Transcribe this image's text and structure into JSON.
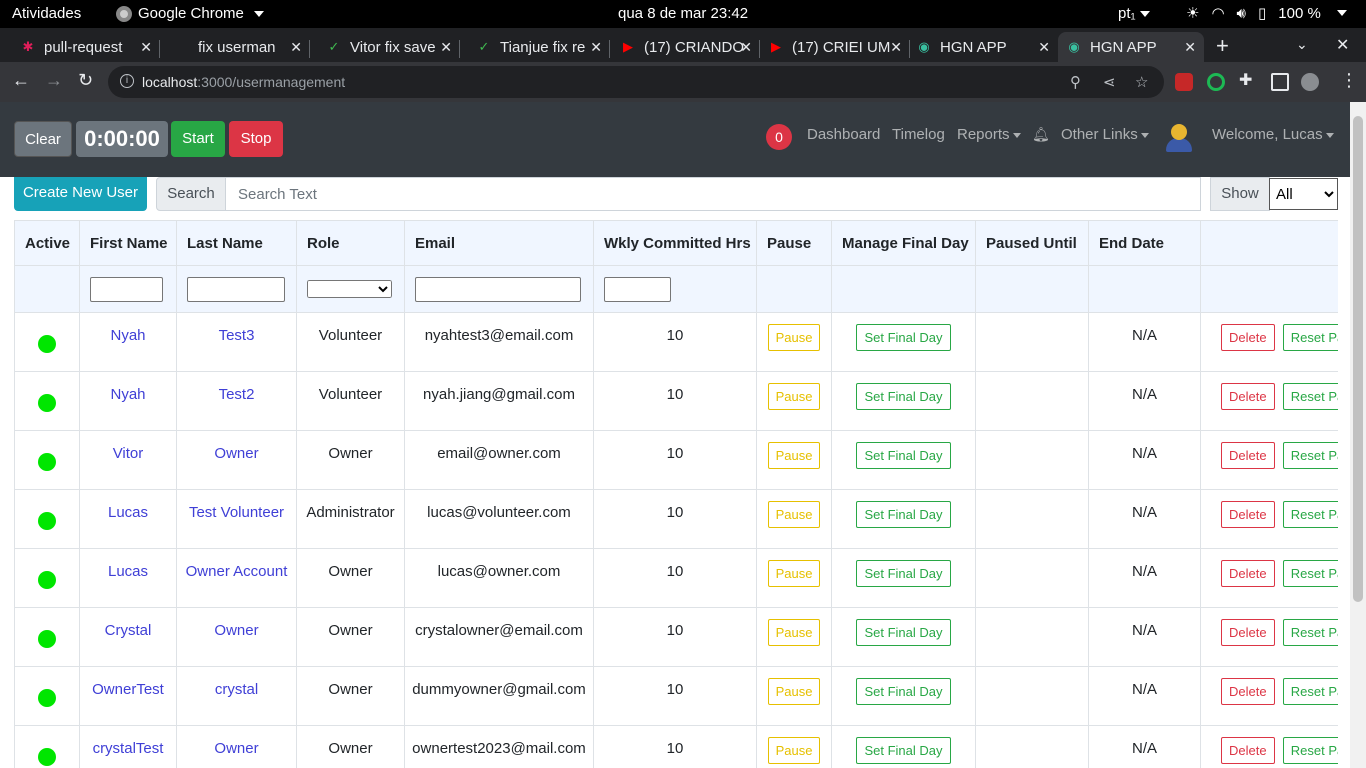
{
  "system": {
    "activities": "Atividades",
    "app_name": "Google Chrome",
    "clock": "qua 8 de mar  23:42",
    "locale": "pt₁",
    "battery": "100 %"
  },
  "browser": {
    "tabs": [
      {
        "label": "pull-request",
        "icon": "slack-icon"
      },
      {
        "label": "fix userman",
        "icon": "github-icon"
      },
      {
        "label": "Vitor fix save",
        "icon": "check-icon"
      },
      {
        "label": "Tianjue fix re",
        "icon": "check-icon"
      },
      {
        "label": "(17) CRIANDO",
        "icon": "youtube-icon"
      },
      {
        "label": "(17) CRIEI UM",
        "icon": "youtube-icon"
      },
      {
        "label": "HGN APP",
        "icon": "hgn-icon"
      },
      {
        "label": "HGN APP",
        "icon": "hgn-icon"
      }
    ],
    "url_host": "localhost",
    "url_path": ":3000/usermanagement"
  },
  "navbar": {
    "clear": "Clear",
    "timer": "0:00:00",
    "start": "Start",
    "stop": "Stop",
    "notification_count": "0",
    "dashboard": "Dashboard",
    "timelog": "Timelog",
    "reports": "Reports",
    "other_links": "Other Links",
    "welcome": "Welcome, Lucas"
  },
  "controls": {
    "create_user": "Create New User",
    "search_label": "Search",
    "search_placeholder": "Search Text",
    "show_label": "Show",
    "show_value": "All"
  },
  "table": {
    "headers": [
      "Active",
      "First Name",
      "Last Name",
      "Role",
      "Email",
      "Wkly Committed Hrs",
      "Pause",
      "Manage Final Day",
      "Paused Until",
      "End Date",
      ""
    ],
    "pause_label": "Pause",
    "final_day_label": "Set Final Day",
    "delete_label": "Delete",
    "reset_label": "Reset Pa",
    "rows": [
      {
        "first": "Nyah",
        "last": "Test3",
        "role": "Volunteer",
        "email": "nyahtest3@email.com",
        "hrs": "10",
        "end": "N/A"
      },
      {
        "first": "Nyah",
        "last": "Test2",
        "role": "Volunteer",
        "email": "nyah.jiang@gmail.com",
        "hrs": "10",
        "end": "N/A"
      },
      {
        "first": "Vitor",
        "last": "Owner",
        "role": "Owner",
        "email": "email@owner.com",
        "hrs": "10",
        "end": "N/A"
      },
      {
        "first": "Lucas",
        "last": "Test Volunteer",
        "role": "Administrator",
        "email": "lucas@volunteer.com",
        "hrs": "10",
        "end": "N/A"
      },
      {
        "first": "Lucas",
        "last": "Owner Account",
        "role": "Owner",
        "email": "lucas@owner.com",
        "hrs": "10",
        "end": "N/A"
      },
      {
        "first": "Crystal",
        "last": "Owner",
        "role": "Owner",
        "email": "crystalowner@email.com",
        "hrs": "10",
        "end": "N/A"
      },
      {
        "first": "OwnerTest",
        "last": "crystal",
        "role": "Owner",
        "email": "dummyowner@gmail.com",
        "hrs": "10",
        "end": "N/A"
      },
      {
        "first": "crystalTest",
        "last": "Owner",
        "role": "Owner",
        "email": "ownertest2023@mail.com",
        "hrs": "10",
        "end": "N/A"
      }
    ]
  },
  "colors": {
    "active_dot": "#00e600",
    "link": "#3f3fd6",
    "navbar_bg": "#343a40",
    "create_btn": "#17a2b8"
  }
}
